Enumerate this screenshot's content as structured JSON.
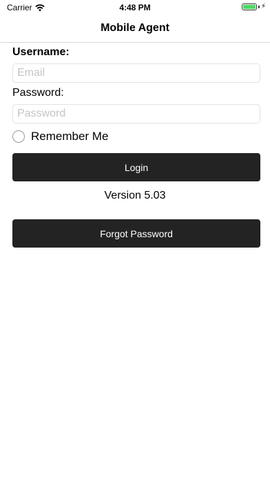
{
  "status_bar": {
    "carrier": "Carrier",
    "time": "4:48 PM",
    "battery_level": 1.0,
    "battery_color": "#4cd964"
  },
  "nav": {
    "title": "Mobile Agent"
  },
  "form": {
    "username_label": "Username:",
    "username_placeholder": "Email",
    "username_value": "",
    "password_label": "Password:",
    "password_placeholder": "Password",
    "password_value": "",
    "remember_label": "Remember Me",
    "remember_checked": false
  },
  "actions": {
    "login_label": "Login",
    "forgot_label": "Forgot Password",
    "button_color": "#232323"
  },
  "version_text": "Version 5.03",
  "icons": {
    "wifi": "wifi-icon",
    "battery": "battery-icon",
    "charging": "bolt-icon"
  }
}
